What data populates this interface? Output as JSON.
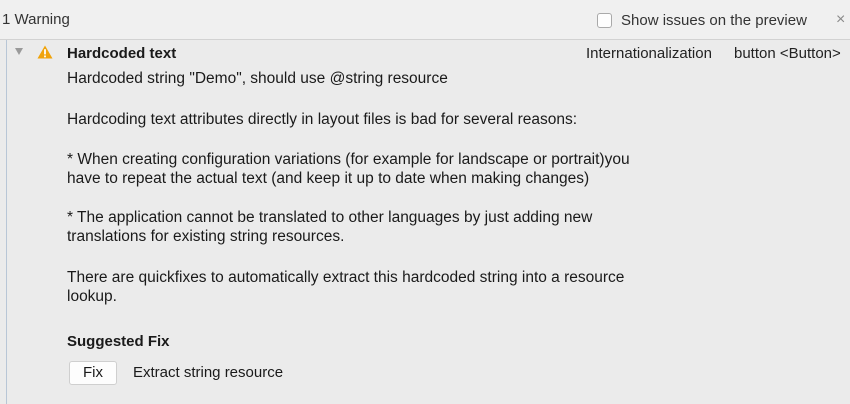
{
  "header": {
    "title": "1 Warning",
    "show_issues_label": "Show issues on the preview",
    "show_issues_checked": false,
    "close_glyph": "×"
  },
  "issue": {
    "severity_icon": "warning-icon",
    "title": "Hardcoded text",
    "category": "Internationalization",
    "component": "button <Button>",
    "summary": "Hardcoded string \"Demo\", should use @string resource",
    "paragraph_1": "Hardcoding text attributes directly in layout files is bad for several reasons:",
    "paragraph_2_line_1": "* When creating configuration variations (for example for landscape or portrait)you",
    "paragraph_2_line_2": "have to repeat the actual text (and keep it up to date when making changes)",
    "paragraph_3_line_1": "* The application cannot be translated to other languages by just adding new",
    "paragraph_3_line_2": "translations for existing string resources.",
    "paragraph_4_line_1": "There are quickfixes to automatically extract this hardcoded string into a resource",
    "paragraph_4_line_2": "lookup.",
    "suggested_fix_heading": "Suggested Fix",
    "fix_button_label": "Fix",
    "fix_description": "Extract string resource"
  },
  "colors": {
    "warning": "#f0a30a",
    "background": "#ececec",
    "divider": "#d2d2d2"
  }
}
